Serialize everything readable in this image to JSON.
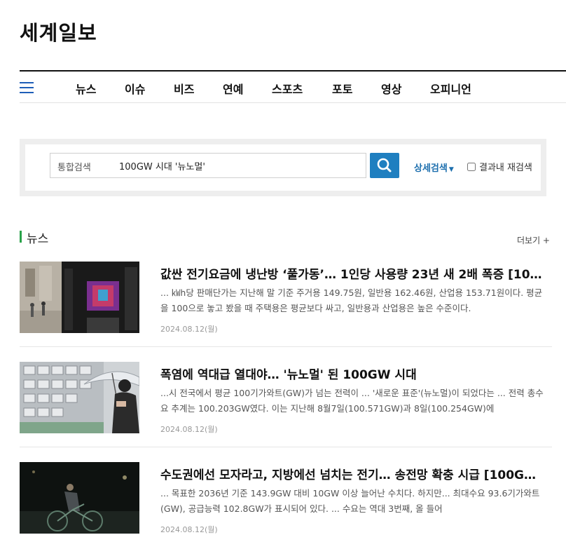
{
  "site": {
    "logo": "세계일보"
  },
  "nav": {
    "items": [
      {
        "label": "뉴스"
      },
      {
        "label": "이슈"
      },
      {
        "label": "비즈"
      },
      {
        "label": "연예"
      },
      {
        "label": "스포츠"
      },
      {
        "label": "포토"
      },
      {
        "label": "영상"
      },
      {
        "label": "오피니언"
      }
    ]
  },
  "search": {
    "scope": "통합검색",
    "query": "100GW 시대 '뉴노멀'",
    "advanced_label": "상세검색",
    "within_results_label": "결과내 재검색",
    "within_results_checked": false
  },
  "news_section": {
    "title": "뉴스",
    "more_label": "더보기 +",
    "accent_color": "#2aa24a",
    "articles": [
      {
        "title": "값싼 전기요금에 냉난방 ‘풀가동’… 1인당 사용량 23년 새 2배 폭증 [10…",
        "snippet": "... ㎾h당 판매단가는 지난해 말 기준 주거용 149.75원, 일반용 162.46원, 산업용 153.71원이다. 평균을 100으로 놓고 봤을 때 주택용은 평균보다 싸고, 일반용과 산업용은 높은 수준이다.",
        "date": "2024.08.12(월)",
        "thumb": "street-storefront-image"
      },
      {
        "title": "폭염에 역대급 열대야… '뉴노멀' 된 100GW 시대",
        "snippet": "...시 전국에서 평균 100기가와트(GW)가 넘는 전력이 ... '새로운 표준'(뉴노멀)이 되었다는 ... 전력 총수요 추계는 100.203GW였다. 이는 지난해 8월7일(100.571GW)과 8일(100.254GW)에",
        "date": "2024.08.12(월)",
        "thumb": "umbrella-woman-air-conditioners-image"
      },
      {
        "title": "수도권에선 모자라고, 지방에선 넘치는 전기… 송전망 확충 시급 [100G…",
        "snippet": "... 목표한 2036년 기준 143.9GW 대비 10GW 이상 늘어난 수치다. 하지만... 최대수요 93.6기가와트(GW), 공급능력 102.8GW가 표시되어 있다. ... 수요는 역대 3번째, 올 들어",
        "date": "2024.08.12(월)",
        "thumb": "night-cyclist-image"
      }
    ]
  },
  "colors": {
    "brand_blue": "#1f7fc0",
    "link_blue": "#1d6fae",
    "menu_blue": "#1f5fb8"
  }
}
